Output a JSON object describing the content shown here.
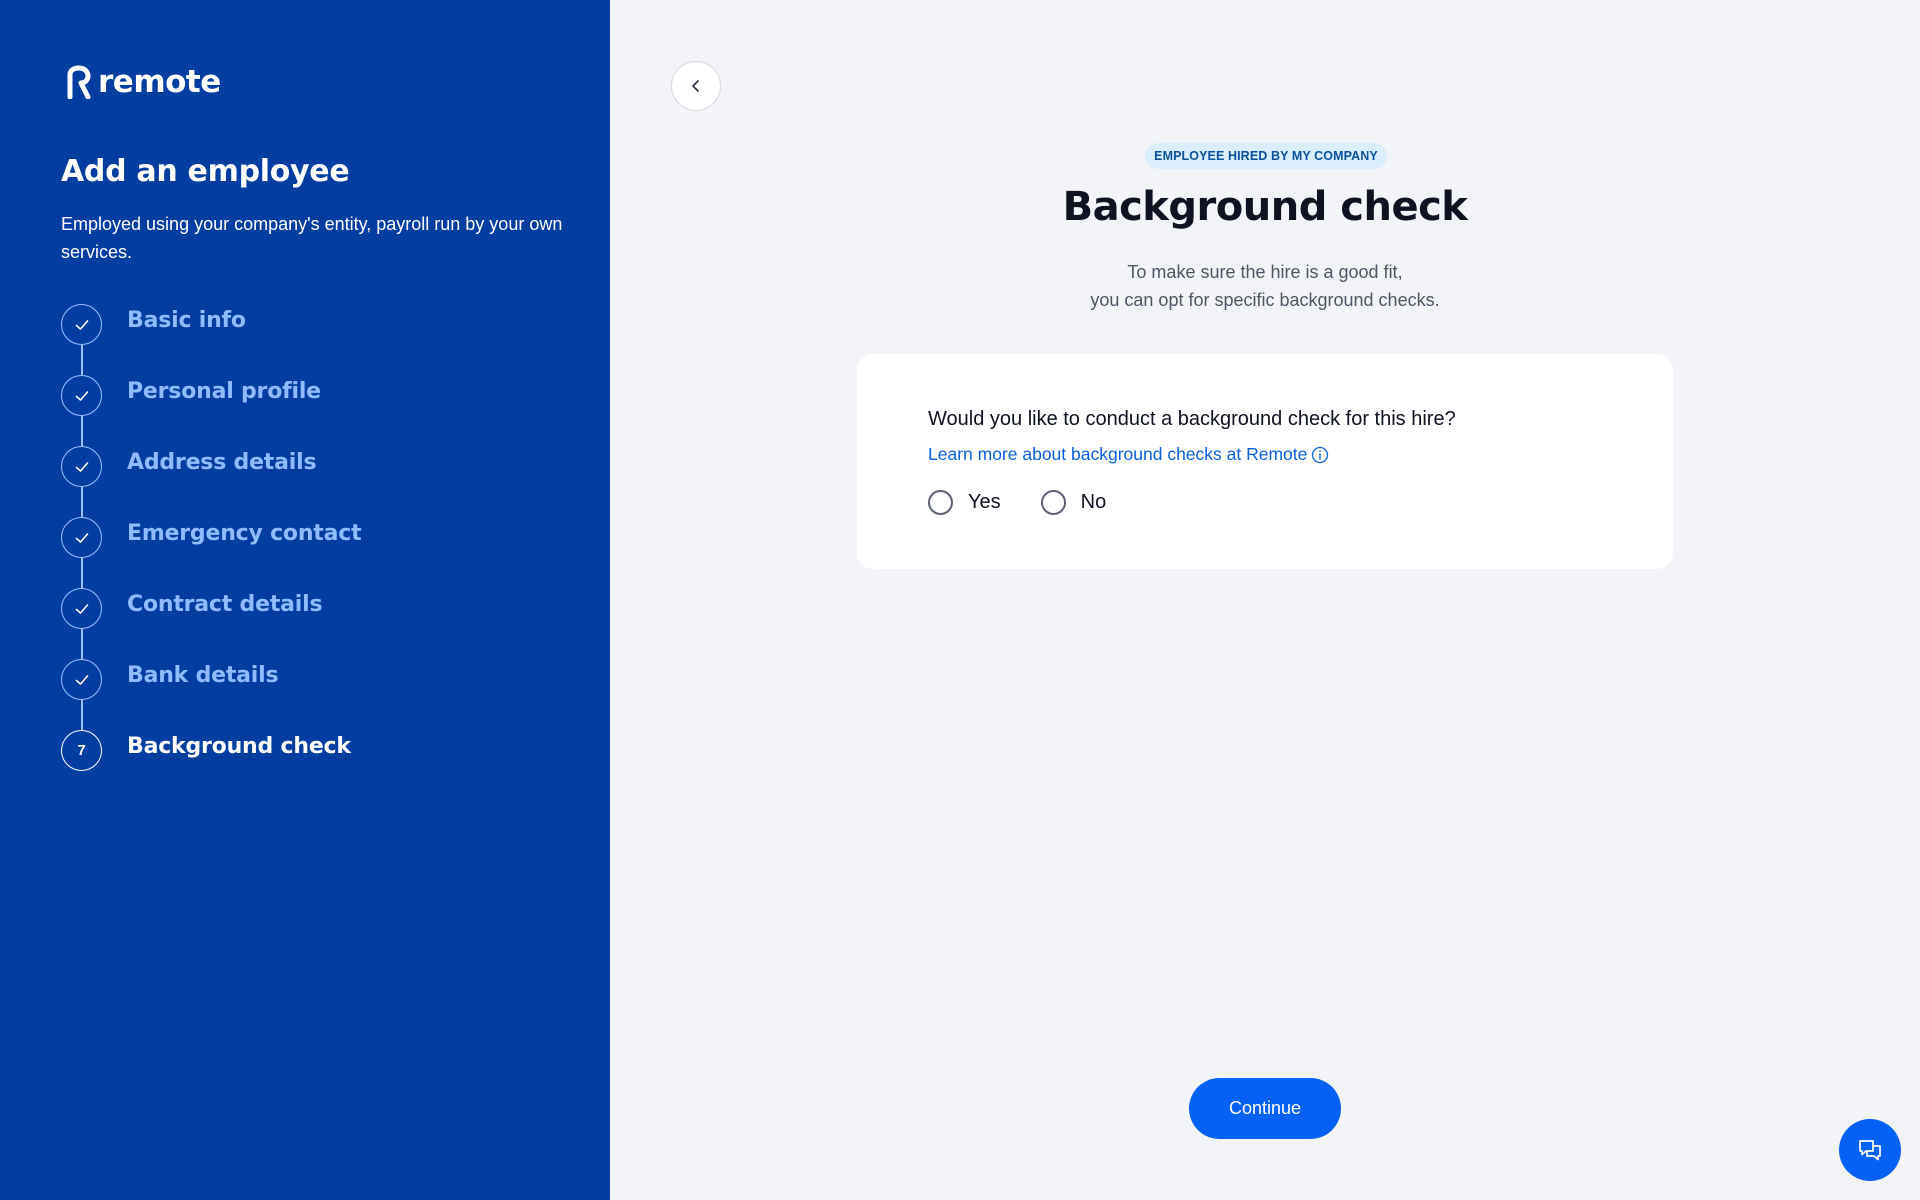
{
  "brand": {
    "name": "remote"
  },
  "sidebar": {
    "title": "Add an employee",
    "subtitle": "Employed using your company's entity, payroll run by your own services.",
    "steps": [
      {
        "label": "Basic info",
        "status": "completed"
      },
      {
        "label": "Personal profile",
        "status": "completed"
      },
      {
        "label": "Address details",
        "status": "completed"
      },
      {
        "label": "Emergency contact",
        "status": "completed"
      },
      {
        "label": "Contract details",
        "status": "completed"
      },
      {
        "label": "Bank details",
        "status": "completed"
      },
      {
        "label": "Background check",
        "status": "current",
        "number": "7"
      }
    ]
  },
  "main": {
    "badge": "EMPLOYEE HIRED BY MY COMPANY",
    "title": "Background check",
    "description_line1": "To make sure the hire is a good fit,",
    "description_line2": "you can opt for specific background checks.",
    "question": "Would you like to conduct a background check for this hire?",
    "learn_more": "Learn more about background checks at Remote",
    "options": [
      {
        "label": "Yes",
        "selected": false
      },
      {
        "label": "No",
        "selected": false
      }
    ],
    "continue_label": "Continue"
  },
  "icons": {
    "back": "chevron-left-icon",
    "info": "info-icon",
    "check": "check-icon",
    "chat": "chat-icon"
  },
  "colors": {
    "sidebar_bg": "#023ea1",
    "primary": "#0361f5",
    "link": "#0a5fde",
    "step_muted": "#8fbcff",
    "page_bg": "#f3f4f8"
  }
}
